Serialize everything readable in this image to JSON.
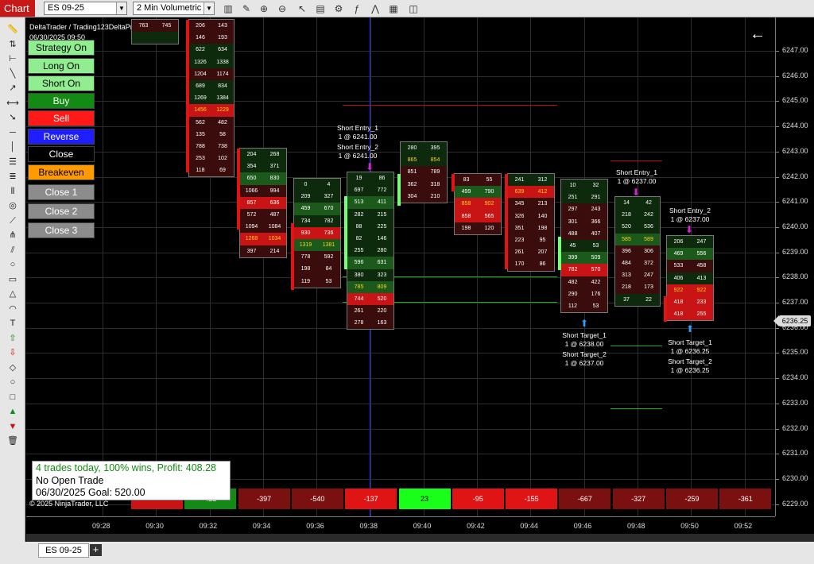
{
  "window": {
    "tab": "Chart"
  },
  "toolbar": {
    "instrument": "ES 09-25",
    "interval": "2 Min Volumetric",
    "icons": [
      "bars-type-icon",
      "pencil-icon",
      "zoom-in-icon",
      "zoom-out-icon",
      "cursor-icon",
      "properties-icon",
      "strategy-icon",
      "indicator-icon",
      "chart-trader-icon",
      "data-box-icon",
      "snapshot-icon"
    ]
  },
  "drawing_tools": [
    "ruler-icon",
    "risk-reward-icon",
    "price-marker-icon",
    "line-icon",
    "ray-icon",
    "extended-line-icon",
    "arrow-line-icon",
    "horizontal-line-icon",
    "vertical-line-icon",
    "fib-retracement-icon",
    "fib-extension-icon",
    "fib-timezone-icon",
    "fib-circle-icon",
    "gann-fan-icon",
    "andrews-pitchfork-icon",
    "regression-channel-icon",
    "ellipse-icon",
    "rectangle-icon",
    "triangle-icon",
    "arc-icon",
    "text-icon",
    "arrow-up-icon",
    "arrow-down-icon",
    "diamond-icon",
    "dot-icon",
    "square-icon",
    "triangle-up-icon",
    "triangle-down-icon",
    "trash-icon"
  ],
  "info": {
    "line1": "DeltaTrader / Trading123DeltaPro",
    "line2": "06/30/2025 09:50"
  },
  "strategy_buttons": [
    {
      "label": "Strategy On",
      "bg": "#90ee90"
    },
    {
      "label": "Long On",
      "bg": "#90ee90"
    },
    {
      "label": "Short On",
      "bg": "#90ee90"
    },
    {
      "label": "Buy",
      "bg": "#138a13",
      "fg": "#ffffff"
    },
    {
      "label": "Sell",
      "bg": "#ff1a1a",
      "fg": "#ffffff"
    },
    {
      "label": "Reverse",
      "bg": "#1e1eff",
      "fg": "#ffffff"
    },
    {
      "label": "Close",
      "bg": "#000000",
      "fg": "#ffffff"
    },
    {
      "label": "Breakeven",
      "bg": "#ff9a00",
      "fg": "#000000"
    },
    {
      "label": "Close 1",
      "bg": "#8c8c8c",
      "fg": "#ffffff"
    },
    {
      "label": "Close 2",
      "bg": "#8c8c8c",
      "fg": "#ffffff"
    },
    {
      "label": "Close 3",
      "bg": "#8c8c8c",
      "fg": "#ffffff"
    }
  ],
  "price_axis": {
    "labels": [
      "6247.00",
      "6246.00",
      "6245.00",
      "6244.00",
      "6243.00",
      "6242.00",
      "6241.00",
      "6240.00",
      "6239.00",
      "6238.00",
      "6237.00",
      "6236.00",
      "6235.00",
      "6234.00",
      "6233.00",
      "6232.00",
      "6231.00",
      "6230.00",
      "6229.00"
    ],
    "last_price": "6236.25"
  },
  "time_axis": [
    "09:28",
    "09:30",
    "09:32",
    "09:34",
    "09:36",
    "09:38",
    "09:40",
    "09:42",
    "09:44",
    "09:46",
    "09:48",
    "09:50",
    "09:52"
  ],
  "footprints": [
    {
      "rows": [
        [
          "763",
          "745"
        ],
        [
          "",
          ""
        ]
      ],
      "partial": true
    },
    {
      "rows": [
        [
          "206",
          "143"
        ],
        [
          "146",
          "193"
        ],
        [
          "622",
          "634"
        ],
        [
          "1326",
          "1338"
        ],
        [
          "1204",
          "1174"
        ],
        [
          "689",
          "834"
        ],
        [
          "1269",
          "1384"
        ],
        [
          "1456",
          "1229"
        ],
        [
          "562",
          "482"
        ],
        [
          "135",
          "58"
        ],
        [
          "788",
          "738"
        ],
        [
          "253",
          "102"
        ],
        [
          "118",
          "69"
        ]
      ]
    },
    {
      "rows": [
        [
          "204",
          "268"
        ],
        [
          "354",
          "371"
        ],
        [
          "650",
          "830"
        ],
        [
          "1066",
          "994"
        ],
        [
          "857",
          "636"
        ],
        [
          "572",
          "487"
        ],
        [
          "1094",
          "1084"
        ],
        [
          "1268",
          "1034"
        ],
        [
          "397",
          "214"
        ]
      ]
    },
    {
      "rows": [
        [
          "0",
          "4"
        ],
        [
          "209",
          "327"
        ],
        [
          "459",
          "670"
        ],
        [
          "734",
          "782"
        ],
        [
          "930",
          "736"
        ],
        [
          "1319",
          "1381"
        ],
        [
          "778",
          "592"
        ],
        [
          "198",
          "84"
        ],
        [
          "119",
          "53"
        ]
      ]
    },
    {
      "rows": [
        [
          "19",
          "86"
        ],
        [
          "697",
          "772"
        ],
        [
          "513",
          "411"
        ],
        [
          "282",
          "215"
        ],
        [
          "88",
          "225"
        ],
        [
          "82",
          "146"
        ],
        [
          "255",
          "280"
        ],
        [
          "596",
          "631"
        ],
        [
          "380",
          "323"
        ],
        [
          "785",
          "809"
        ],
        [
          "744",
          "520"
        ],
        [
          "261",
          "220"
        ],
        [
          "278",
          "163"
        ]
      ]
    },
    {
      "rows": [
        [
          "280",
          "395"
        ],
        [
          "865",
          "854"
        ],
        [
          "851",
          "789"
        ],
        [
          "362",
          "318"
        ],
        [
          "304",
          "210"
        ]
      ]
    },
    {
      "rows": [
        [
          "83",
          "55"
        ],
        [
          "499",
          "790"
        ],
        [
          "858",
          "902"
        ],
        [
          "858",
          "565"
        ],
        [
          "198",
          "120"
        ]
      ]
    },
    {
      "rows": [
        [
          "241",
          "312"
        ],
        [
          "639",
          "412"
        ],
        [
          "345",
          "213"
        ],
        [
          "326",
          "140"
        ],
        [
          "351",
          "198"
        ],
        [
          "223",
          "95"
        ],
        [
          "261",
          "207"
        ],
        [
          "170",
          "86"
        ]
      ]
    },
    {
      "rows": [
        [
          "10",
          "32"
        ],
        [
          "251",
          "291"
        ],
        [
          "297",
          "243"
        ],
        [
          "301",
          "366"
        ],
        [
          "488",
          "407"
        ],
        [
          "45",
          "53"
        ],
        [
          "399",
          "509"
        ],
        [
          "782",
          "570"
        ],
        [
          "482",
          "422"
        ],
        [
          "290",
          "176"
        ],
        [
          "112",
          "53"
        ]
      ]
    },
    {
      "rows": [
        [
          "14",
          "42"
        ],
        [
          "218",
          "242"
        ],
        [
          "520",
          "536"
        ],
        [
          "585",
          "589"
        ],
        [
          "396",
          "306"
        ],
        [
          "484",
          "372"
        ],
        [
          "313",
          "247"
        ],
        [
          "218",
          "173"
        ],
        [
          "37",
          "22"
        ]
      ]
    },
    {
      "rows": [
        [
          "206",
          "247"
        ],
        [
          "469",
          "556"
        ],
        [
          "533",
          "458"
        ],
        [
          "406",
          "413"
        ],
        [
          "922",
          "922"
        ],
        [
          "418",
          "233"
        ],
        [
          "418",
          "255"
        ]
      ]
    }
  ],
  "annotations": {
    "short_entry_1_a": "Short Entry_1",
    "short_entry_1_a_price": "1 @ 6241.00",
    "short_entry_2_a": "Short Entry_2",
    "short_entry_2_a_price": "1 @ 6241.00",
    "short_entry_1_b": "Short Entry_1",
    "short_entry_1_b_price": "1 @ 6237.00",
    "short_entry_2_b": "Short Entry_2",
    "short_entry_2_b_price": "1 @ 6237.00",
    "short_target_1_a": "Short Target_1",
    "short_target_1_a_price": "1 @ 6238.00",
    "short_target_2_a": "Short Target_2",
    "short_target_2_a_price": "1 @ 6237.00",
    "short_target_1_b": "Short Target_1",
    "short_target_1_b_price": "1 @ 6236.25",
    "short_target_2_b": "Short Target_2",
    "short_target_2_b_price": "1 @ 6236.25"
  },
  "stats": {
    "line1": "4 trades today, 100% wins, Profit: 408.28",
    "line2": "No Open Trade",
    "line3": "06/30/2025 Goal: 520.00",
    "line1_color": "#138a13"
  },
  "copyright": "© 2025 NinjaTrader, LLC",
  "delta_row": [
    {
      "value": "",
      "color": "#c81414"
    },
    {
      "value": "422",
      "color": "#138a13"
    },
    {
      "value": "-397",
      "color": "#7a1010"
    },
    {
      "value": "-540",
      "color": "#7a1010"
    },
    {
      "value": "-137",
      "color": "#e01414"
    },
    {
      "value": "23",
      "color": "#1aff1a"
    },
    {
      "value": "-95",
      "color": "#e01414"
    },
    {
      "value": "-155",
      "color": "#e01414"
    },
    {
      "value": "-667",
      "color": "#7a1010"
    },
    {
      "value": "-327",
      "color": "#7a1010"
    },
    {
      "value": "-259",
      "color": "#7a1010"
    },
    {
      "value": "-361",
      "color": "#7a1010"
    }
  ],
  "bottom_tab": "ES 09-25"
}
